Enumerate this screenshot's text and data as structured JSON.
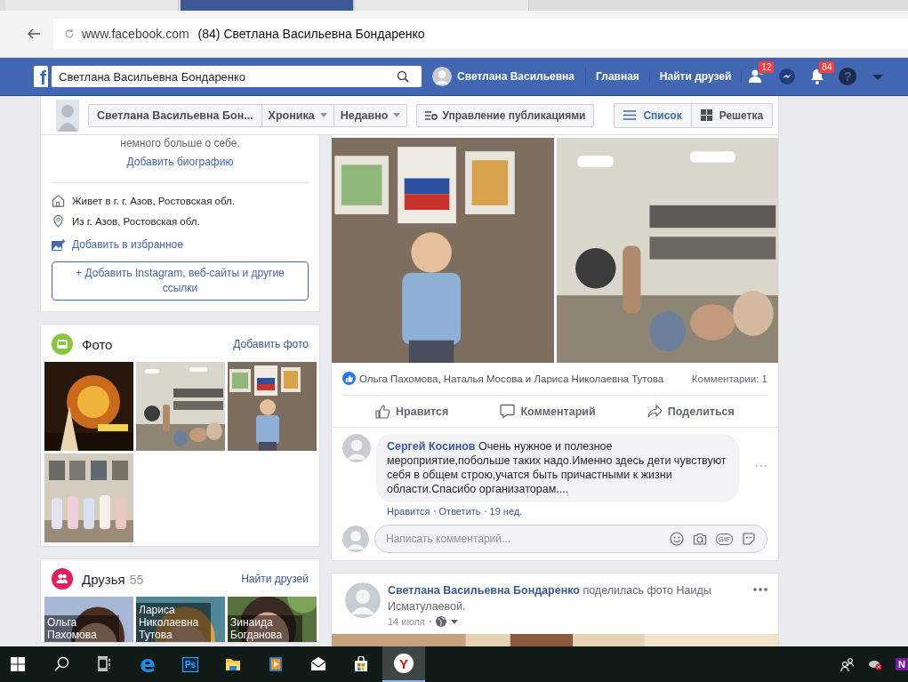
{
  "browser": {
    "tabs": [
      {
        "selected": false
      },
      {
        "selected": true
      },
      {
        "selected": false
      }
    ],
    "domain": "www.facebook.com",
    "page_title": "(84) Светлана Васильевна Бондаренко"
  },
  "navbar": {
    "logo": "f",
    "search_value": "Светлана Васильевна Бондаренко",
    "profile_name": "Светлана Васильевна",
    "links": [
      "Главная",
      "Найти друзей"
    ],
    "icons": [
      {
        "kind": "friends",
        "badge": "12"
      },
      {
        "kind": "messenger"
      },
      {
        "kind": "notifications",
        "badge": "84"
      },
      {
        "kind": "help",
        "label": "?"
      },
      {
        "kind": "menu"
      }
    ]
  },
  "timeline_bar": {
    "name": "Светлана Васильевна Бон...",
    "dropdowns": [
      "Хроника",
      "Недавно"
    ],
    "manage": "Управление публикациями",
    "views": [
      {
        "kind": "list",
        "label": "Список",
        "selected": true
      },
      {
        "kind": "grid",
        "label": "Решетка",
        "selected": false
      }
    ]
  },
  "intro": {
    "text": "немного больше о себе.",
    "bio_link": "Добавить биографию",
    "details": [
      {
        "kind": "home",
        "text": "Живет в г. г. Азов, Ростовская обл."
      },
      {
        "kind": "pin",
        "text": "Из г. Азов, Ростовская обл."
      }
    ],
    "featured_link": "Добавить в избранное",
    "links_button": "+ Добавить Instagram, веб-сайты и другие ссылки"
  },
  "photos": {
    "title": "Фото",
    "action": "Добавить фото"
  },
  "friends": {
    "title": "Друзья",
    "count": "55",
    "action": "Найти друзей",
    "items": [
      {
        "name": "Ольга Пахомова"
      },
      {
        "name": "Лариса Николаевна Тутова"
      },
      {
        "name": "Зинаида Богданова"
      }
    ]
  },
  "post": {
    "likes": "Ольга Пахомова, Наталья Мосова и Лариса Николаевна Тутова",
    "comments_count": "Комментарии: 1",
    "actions": [
      {
        "kind": "like",
        "label": "Нравится"
      },
      {
        "kind": "comment",
        "label": "Комментарий"
      },
      {
        "kind": "share",
        "label": "Поделиться"
      }
    ],
    "comments": [
      {
        "author": "Сергей Косинов",
        "text": "Очень нужное и полезное мероприятие,побольше таких надо.Именно здесь дети чувствуют себя в общем строю,учатся быть причастными к жизни области.Спасибо организаторам....",
        "meta": [
          "Нравится",
          "Ответить",
          "19 нед."
        ]
      }
    ],
    "comment_placeholder": "Написать комментарий...",
    "gif_label": "GIF"
  },
  "post2": {
    "author": "Светлана Васильевна Бондаренко",
    "action_text": "поделилась фото Наиды Исматулаевой.",
    "date": "14 июля"
  },
  "taskbar": {
    "apps": [
      {
        "kind": "search",
        "selected": false
      },
      {
        "kind": "task-view",
        "selected": false
      },
      {
        "kind": "edge",
        "label": "e",
        "selected": false
      },
      {
        "kind": "photoshop",
        "label": "Ps",
        "selected": false
      },
      {
        "kind": "explorer",
        "selected": false
      },
      {
        "kind": "media",
        "selected": false
      },
      {
        "kind": "mail",
        "selected": false
      },
      {
        "kind": "store",
        "selected": false
      },
      {
        "kind": "yandex",
        "label": "Y",
        "selected": true
      }
    ],
    "tray": [
      {
        "kind": "people"
      },
      {
        "kind": "network"
      },
      {
        "kind": "onenote",
        "label": "N"
      }
    ]
  }
}
